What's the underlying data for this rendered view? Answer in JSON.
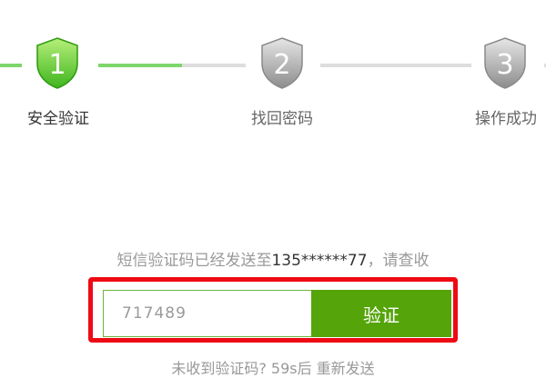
{
  "steps": [
    {
      "number": "1",
      "label": "安全验证",
      "state": "active"
    },
    {
      "number": "2",
      "label": "找回密码",
      "state": "pending"
    },
    {
      "number": "3",
      "label": "操作成功",
      "state": "pending"
    }
  ],
  "colors": {
    "active_green": "#7ed66b",
    "button_green": "#54a40a",
    "inactive_gray": "#dddddd",
    "highlight_red": "#ee0a14"
  },
  "verification": {
    "message_prefix": "短信验证码已经发送至",
    "phone_masked": "135******77",
    "message_suffix": "，请查收",
    "code_value": "717489",
    "verify_label": "验证",
    "resend_text": "未收到验证码? 59s后 重新发送"
  }
}
